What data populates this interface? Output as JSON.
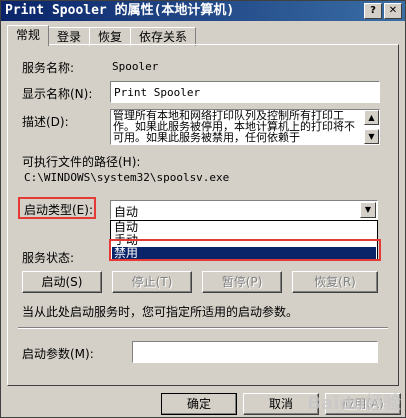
{
  "window": {
    "title": "Print Spooler 的属性(本地计算机)",
    "help_btn": "?",
    "close_btn": "✕"
  },
  "tabs": [
    {
      "label": "常规"
    },
    {
      "label": "登录"
    },
    {
      "label": "恢复"
    },
    {
      "label": "依存关系"
    }
  ],
  "general": {
    "service_name_label": "服务名称:",
    "service_name_value": "Spooler",
    "display_name_label": "显示名称(N):",
    "display_name_value": "Print Spooler",
    "description_label": "描述(D):",
    "description_text": "管理所有本地和网络打印队列及控制所有打印工作。如果此服务被停用，本地计算机上的打印将不可用。如果此服务被禁用，任何依赖于",
    "exe_path_label": "可执行文件的路径(H):",
    "exe_path_value": "C:\\WINDOWS\\system32\\spoolsv.exe",
    "startup_type_label": "启动类型(E):",
    "startup_type_value": "自动",
    "startup_options": [
      "自动",
      "手动",
      "禁用"
    ],
    "service_status_label": "服务状态:",
    "start_btn": "启动(S)",
    "stop_btn": "停止(T)",
    "pause_btn": "暂停(P)",
    "resume_btn": "恢复(R)",
    "hint": "当从此处启动服务时，您可指定所适用的启动参数。",
    "params_label": "启动参数(M):",
    "params_value": ""
  },
  "footer": {
    "ok": "确定",
    "cancel": "取消",
    "apply": "应用(A)"
  },
  "watermark": "Baidu经验",
  "colors": {
    "highlight": "#0a246a",
    "annotation_red": "#e53935"
  }
}
